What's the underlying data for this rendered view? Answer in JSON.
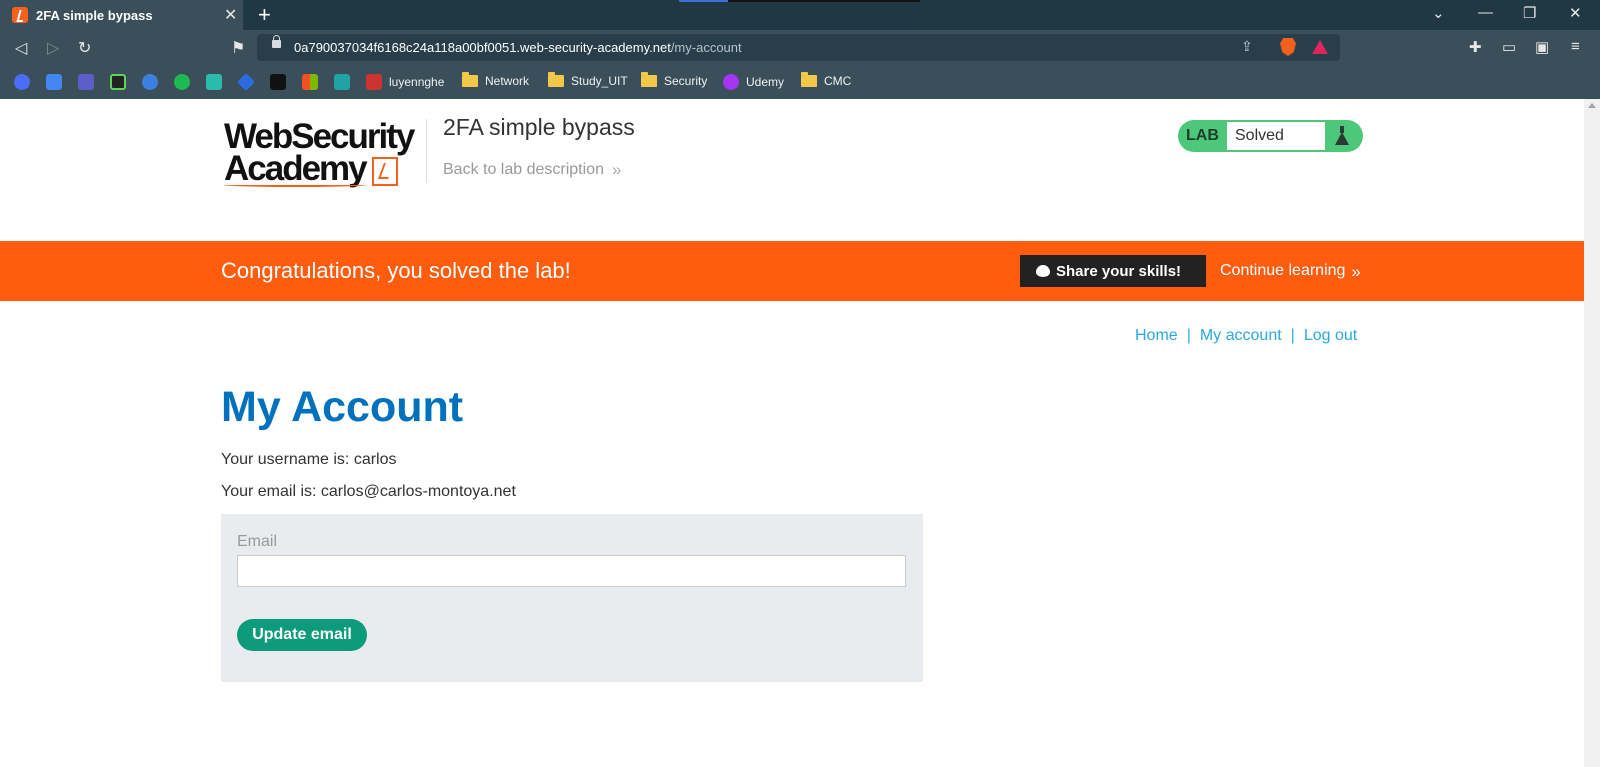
{
  "browser": {
    "tab_title": "2FA simple bypass",
    "tab_close": "✕",
    "new_tab": "+",
    "window_controls": [
      "⌄",
      "—",
      "❐",
      "✕"
    ],
    "nav": {
      "back": "◁",
      "forward": "▷",
      "reload": "↻",
      "bookmark": "⚑"
    },
    "url_host": "0a790037034f6168c24a118a00bf0051.web-security-academy.net",
    "url_path": "/my-account",
    "omni_share": "⇪",
    "toolbar_icons": [
      "✚",
      "▭",
      "▣",
      "≡"
    ],
    "bookmark_items": [
      {
        "label": "luyennghe",
        "type": "site"
      },
      {
        "label": "Network",
        "type": "folder"
      },
      {
        "label": "Study_UIT",
        "type": "folder"
      },
      {
        "label": "Security",
        "type": "folder"
      },
      {
        "label": "Udemy",
        "type": "site"
      },
      {
        "label": "CMC",
        "type": "folder"
      }
    ],
    "bookmark_icon_colors": [
      "#4a6cf7",
      "#4285f4",
      "#5b5fc7",
      "#222",
      "#3d7fe0",
      "#1db954",
      "#2bbbad",
      "#2d6ae0",
      "#111",
      "#f25022",
      "#21a3a3"
    ]
  },
  "header": {
    "logo_line1": "WebSecurity",
    "logo_line2": "Academy",
    "lab_title": "2FA simple bypass",
    "back_link": "Back to lab description",
    "back_chevron": "»",
    "lab_label": "LAB",
    "lab_status": "Solved"
  },
  "banner": {
    "message": "Congratulations, you solved the lab!",
    "share_label": "Share your skills!",
    "continue_label": "Continue learning",
    "continue_chevron": "»"
  },
  "nav": {
    "home": "Home",
    "sep": "|",
    "my_account": "My account",
    "log_out": "Log out"
  },
  "main": {
    "heading": "My Account",
    "username_line": "Your username is: carlos",
    "email_line": "Your email is: carlos@carlos-montoya.net",
    "email_label": "Email",
    "email_value": "",
    "update_button": "Update email"
  },
  "colors": {
    "chrome": "#3a4f59",
    "banner": "#ff5c0f",
    "heading": "#0071bc",
    "link": "#29a9e0",
    "badge": "#4dc87b",
    "button": "#0e9b7c"
  }
}
